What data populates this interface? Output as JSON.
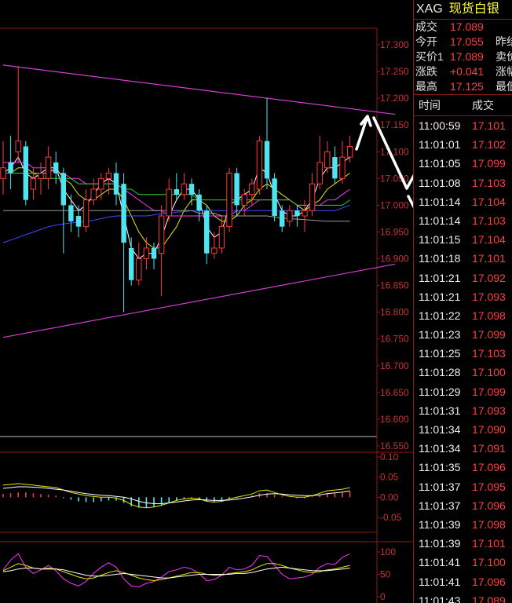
{
  "quote_panel": {
    "symbol": "XAG",
    "name": "现货白银",
    "rows": [
      {
        "label": "成交",
        "value": "17.089",
        "label2": ""
      },
      {
        "label": "今开",
        "value": "17.055",
        "label2": "昨结"
      },
      {
        "label": "买价1",
        "value": "17.089",
        "label2": "卖价"
      },
      {
        "label": "涨跌",
        "value": "+0.041",
        "label2": "涨幅"
      },
      {
        "label": "最高",
        "value": "17.125",
        "label2": "最低"
      }
    ]
  },
  "trades": {
    "col_time": "时间",
    "col_price": "成交",
    "rows": [
      {
        "time": "11:00:59",
        "price": "17.101"
      },
      {
        "time": "11:01:01",
        "price": "17.102"
      },
      {
        "time": "11:01:05",
        "price": "17.099"
      },
      {
        "time": "11:01:08",
        "price": "17.103"
      },
      {
        "time": "11:01:14",
        "price": "17.104"
      },
      {
        "time": "11:01:14",
        "price": "17.103"
      },
      {
        "time": "11:01:15",
        "price": "17.104"
      },
      {
        "time": "11:01:18",
        "price": "17.101"
      },
      {
        "time": "11:01:21",
        "price": "17.092"
      },
      {
        "time": "11:01:21",
        "price": "17.093"
      },
      {
        "time": "11:01:22",
        "price": "17.098"
      },
      {
        "time": "11:01:23",
        "price": "17.099"
      },
      {
        "time": "11:01:25",
        "price": "17.103"
      },
      {
        "time": "11:01:28",
        "price": "17.100"
      },
      {
        "time": "11:01:29",
        "price": "17.099"
      },
      {
        "time": "11:01:31",
        "price": "17.093"
      },
      {
        "time": "11:01:34",
        "price": "17.090"
      },
      {
        "time": "11:01:34",
        "price": "17.091"
      },
      {
        "time": "11:01:35",
        "price": "17.096"
      },
      {
        "time": "11:01:37",
        "price": "17.095"
      },
      {
        "time": "11:01:37",
        "price": "17.096"
      },
      {
        "time": "11:01:39",
        "price": "17.098"
      },
      {
        "time": "11:01:39",
        "price": "17.101"
      },
      {
        "time": "11:01:41",
        "price": "17.100"
      },
      {
        "time": "11:01:41",
        "price": "17.096"
      },
      {
        "time": "11:01:43",
        "price": "17.089"
      }
    ]
  },
  "chart_data": [
    {
      "type": "candlestick",
      "panel": "price",
      "ylim": [
        16.52,
        17.33
      ],
      "y_ticks": [
        "17.300",
        "17.250",
        "17.200",
        "17.150",
        "17.100",
        "17.050",
        "17.000",
        "16.950",
        "16.900",
        "16.850",
        "16.800",
        "16.750",
        "16.700",
        "16.650",
        "16.600",
        "16.550"
      ],
      "candles": [
        {
          "o": 17.05,
          "c": 17.07,
          "h": 17.12,
          "l": 17.02
        },
        {
          "o": 17.08,
          "c": 17.06,
          "h": 17.13,
          "l": 17.03
        },
        {
          "o": 17.1,
          "c": 17.12,
          "h": 17.26,
          "l": 17.08
        },
        {
          "o": 17.11,
          "c": 17.01,
          "h": 17.12,
          "l": 17.0
        },
        {
          "o": 17.03,
          "c": 17.05,
          "h": 17.07,
          "l": 17.01
        },
        {
          "o": 17.05,
          "c": 17.06,
          "h": 17.08,
          "l": 17.02
        },
        {
          "o": 17.05,
          "c": 17.09,
          "h": 17.11,
          "l": 17.03
        },
        {
          "o": 17.08,
          "c": 17.06,
          "h": 17.1,
          "l": 17.04
        },
        {
          "o": 17.06,
          "c": 17.0,
          "h": 17.07,
          "l": 16.91
        },
        {
          "o": 17.0,
          "c": 16.97,
          "h": 17.02,
          "l": 16.95
        },
        {
          "o": 16.98,
          "c": 16.96,
          "h": 17.0,
          "l": 16.94
        },
        {
          "o": 16.96,
          "c": 17.01,
          "h": 17.03,
          "l": 16.95
        },
        {
          "o": 17.01,
          "c": 17.03,
          "h": 17.05,
          "l": 17.0
        },
        {
          "o": 17.03,
          "c": 17.05,
          "h": 17.06,
          "l": 17.01
        },
        {
          "o": 17.05,
          "c": 17.06,
          "h": 17.07,
          "l": 17.02
        },
        {
          "o": 17.06,
          "c": 17.02,
          "h": 17.08,
          "l": 17.0
        },
        {
          "o": 17.04,
          "c": 16.93,
          "h": 17.06,
          "l": 16.8
        },
        {
          "o": 16.92,
          "c": 16.86,
          "h": 16.94,
          "l": 16.85
        },
        {
          "o": 16.86,
          "c": 16.9,
          "h": 16.93,
          "l": 16.85
        },
        {
          "o": 16.9,
          "c": 16.92,
          "h": 16.94,
          "l": 16.88
        },
        {
          "o": 16.92,
          "c": 16.9,
          "h": 16.93,
          "l": 16.88
        },
        {
          "o": 16.91,
          "c": 16.98,
          "h": 17.0,
          "l": 16.83
        },
        {
          "o": 16.98,
          "c": 17.03,
          "h": 17.05,
          "l": 16.97
        },
        {
          "o": 17.03,
          "c": 17.02,
          "h": 17.06,
          "l": 17.01
        },
        {
          "o": 17.02,
          "c": 17.04,
          "h": 17.06,
          "l": 17.01
        },
        {
          "o": 17.04,
          "c": 17.02,
          "h": 17.05,
          "l": 17.0
        },
        {
          "o": 17.02,
          "c": 16.99,
          "h": 17.03,
          "l": 16.97
        },
        {
          "o": 16.99,
          "c": 16.91,
          "h": 17.0,
          "l": 16.89
        },
        {
          "o": 16.91,
          "c": 16.92,
          "h": 16.95,
          "l": 16.9
        },
        {
          "o": 16.92,
          "c": 16.96,
          "h": 16.98,
          "l": 16.91
        },
        {
          "o": 16.96,
          "c": 17.06,
          "h": 17.07,
          "l": 16.95
        },
        {
          "o": 17.06,
          "c": 17.0,
          "h": 17.07,
          "l": 16.98
        },
        {
          "o": 17.0,
          "c": 17.02,
          "h": 17.03,
          "l": 16.98
        },
        {
          "o": 17.02,
          "c": 17.04,
          "h": 17.05,
          "l": 17.0
        },
        {
          "o": 17.03,
          "c": 17.12,
          "h": 17.13,
          "l": 17.02
        },
        {
          "o": 17.12,
          "c": 17.05,
          "h": 17.2,
          "l": 17.03
        },
        {
          "o": 17.05,
          "c": 16.98,
          "h": 17.06,
          "l": 16.97
        },
        {
          "o": 16.99,
          "c": 16.96,
          "h": 17.0,
          "l": 16.95
        },
        {
          "o": 16.97,
          "c": 16.99,
          "h": 17.0,
          "l": 16.96
        },
        {
          "o": 16.99,
          "c": 16.98,
          "h": 17.0,
          "l": 16.96
        },
        {
          "o": 16.98,
          "c": 16.99,
          "h": 17.01,
          "l": 16.95
        },
        {
          "o": 16.99,
          "c": 17.04,
          "h": 17.06,
          "l": 16.98
        },
        {
          "o": 17.04,
          "c": 17.08,
          "h": 17.13,
          "l": 17.03
        },
        {
          "o": 17.07,
          "c": 17.1,
          "h": 17.12,
          "l": 17.06
        },
        {
          "o": 17.09,
          "c": 17.05,
          "h": 17.11,
          "l": 17.04
        },
        {
          "o": 17.05,
          "c": 17.09,
          "h": 17.12,
          "l": 17.04
        },
        {
          "o": 17.09,
          "c": 17.11,
          "h": 17.13,
          "l": 17.08
        }
      ],
      "trend_lines": [
        {
          "from": [
            0,
            17.262
          ],
          "to": [
            52,
            17.17
          ]
        },
        {
          "from": [
            0,
            16.753
          ],
          "to": [
            52,
            16.89
          ]
        }
      ],
      "moving_averages": [
        {
          "color": "#ffffff",
          "values": [
            17.06,
            17.07,
            17.09,
            17.06,
            17.05,
            17.06,
            17.07,
            17.07,
            17.03,
            17.01,
            16.99,
            17.0,
            17.02,
            17.04,
            17.05,
            17.04,
            16.98,
            16.92,
            16.9,
            16.91,
            16.91,
            16.94,
            16.98,
            17.01,
            17.03,
            17.03,
            17.01,
            16.96,
            16.94,
            16.95,
            17.0,
            17.01,
            17.02,
            17.03,
            17.07,
            17.06,
            17.02,
            16.99,
            16.98,
            16.98,
            16.99,
            17.01,
            17.05,
            17.07,
            17.07,
            17.08,
            17.09
          ]
        },
        {
          "color": "#e6e600",
          "values": [
            17.06,
            17.06,
            17.07,
            17.07,
            17.06,
            17.06,
            17.06,
            17.07,
            17.05,
            17.04,
            17.02,
            17.01,
            17.01,
            17.02,
            17.03,
            17.03,
            17.01,
            16.98,
            16.95,
            16.93,
            16.92,
            16.92,
            16.94,
            16.96,
            16.99,
            17.01,
            17.01,
            17.0,
            16.98,
            16.97,
            16.97,
            16.98,
            17.0,
            17.01,
            17.03,
            17.04,
            17.03,
            17.02,
            17.01,
            17.0,
            16.99,
            17.0,
            17.01,
            17.03,
            17.04,
            17.05,
            17.06
          ]
        },
        {
          "color": "#ff33ff",
          "values": [
            17.08,
            17.08,
            17.08,
            17.08,
            17.07,
            17.07,
            17.07,
            17.06,
            17.06,
            17.05,
            17.05,
            17.04,
            17.04,
            17.04,
            17.04,
            17.04,
            17.03,
            17.02,
            17.01,
            17.0,
            16.99,
            16.99,
            16.98,
            16.98,
            16.98,
            16.98,
            16.98,
            16.98,
            16.98,
            16.98,
            16.98,
            16.99,
            16.99,
            17.0,
            17.01,
            17.01,
            17.01,
            17.01,
            17.01,
            17.0,
            17.0,
            17.0,
            17.0,
            17.01,
            17.01,
            17.02,
            17.03
          ]
        },
        {
          "color": "#33cc33",
          "values": [
            17.06,
            17.06,
            17.06,
            17.06,
            17.06,
            17.05,
            17.05,
            17.05,
            17.05,
            17.05,
            17.04,
            17.04,
            17.04,
            17.04,
            17.04,
            17.04,
            17.03,
            17.03,
            17.02,
            17.02,
            17.02,
            17.02,
            17.02,
            17.02,
            17.02,
            17.02,
            17.01,
            17.01,
            17.01,
            17.01,
            17.01,
            17.01,
            17.01,
            17.01,
            17.01,
            17.01,
            17.01,
            17.01,
            17.01,
            17.0,
            17.0,
            17.0,
            17.0,
            17.0,
            17.0,
            17.0,
            17.01
          ]
        },
        {
          "color": "#3a4cff",
          "values": [
            16.93,
            16.935,
            16.94,
            16.945,
            16.95,
            16.955,
            16.96,
            16.963,
            16.965,
            16.967,
            16.968,
            16.97,
            16.972,
            16.975,
            16.978,
            16.98,
            16.98,
            16.98,
            16.98,
            16.98,
            16.982,
            16.984,
            16.985,
            16.987,
            16.988,
            16.99,
            16.99,
            16.99,
            16.99,
            16.99,
            16.99,
            16.99,
            16.99,
            16.99,
            16.99,
            16.99,
            16.99,
            16.99,
            16.99,
            16.99,
            16.99,
            16.99,
            16.99,
            16.99,
            16.99,
            16.995,
            17.0
          ]
        },
        {
          "color": "#9a9a9a",
          "values": [
            16.99,
            16.99,
            16.99,
            16.99,
            16.99,
            16.99,
            16.99,
            16.99,
            16.99,
            16.99,
            16.99,
            16.99,
            16.99,
            16.99,
            16.99,
            16.99,
            16.99,
            16.99,
            16.99,
            16.99,
            16.99,
            16.99,
            16.99,
            16.99,
            16.99,
            16.99,
            16.985,
            16.985,
            16.985,
            16.98,
            16.98,
            16.98,
            16.98,
            16.98,
            16.98,
            16.98,
            16.978,
            16.976,
            16.975,
            16.974,
            16.973,
            16.972,
            16.971,
            16.97,
            16.97,
            16.97,
            16.97
          ]
        }
      ]
    },
    {
      "type": "bar",
      "panel": "macd",
      "ylim": [
        -0.075,
        0.12
      ],
      "y_ticks": [
        "0.10",
        "0.05",
        "0.00",
        "-0.05"
      ],
      "values": [
        0.008,
        0.01,
        0.012,
        0.012,
        0.01,
        0.008,
        0.006,
        0.004,
        -0.002,
        -0.006,
        -0.01,
        -0.012,
        -0.012,
        -0.01,
        -0.008,
        -0.008,
        -0.014,
        -0.022,
        -0.026,
        -0.026,
        -0.024,
        -0.02,
        -0.014,
        -0.008,
        -0.004,
        -0.002,
        -0.004,
        -0.01,
        -0.012,
        -0.01,
        -0.004,
        -0.002,
        0.0,
        0.004,
        0.01,
        0.01,
        0.006,
        0.002,
        0.0,
        -0.002,
        -0.002,
        0.002,
        0.006,
        0.01,
        0.01,
        0.012,
        0.014
      ],
      "lines": [
        {
          "color": "#e6e600",
          "values": [
            0.03,
            0.032,
            0.034,
            0.032,
            0.03,
            0.028,
            0.026,
            0.024,
            0.018,
            0.012,
            0.008,
            0.004,
            0.002,
            0.0,
            0.0,
            -0.002,
            -0.008,
            -0.018,
            -0.024,
            -0.026,
            -0.024,
            -0.02,
            -0.014,
            -0.008,
            -0.004,
            -0.002,
            -0.004,
            -0.01,
            -0.012,
            -0.01,
            -0.004,
            0.0,
            0.004,
            0.008,
            0.016,
            0.018,
            0.012,
            0.006,
            0.002,
            0.0,
            0.0,
            0.004,
            0.01,
            0.016,
            0.018,
            0.02,
            0.024
          ]
        },
        {
          "color": "#ffffff",
          "values": [
            0.022,
            0.024,
            0.026,
            0.026,
            0.025,
            0.024,
            0.022,
            0.02,
            0.018,
            0.015,
            0.012,
            0.009,
            0.007,
            0.005,
            0.004,
            0.002,
            0.0,
            -0.004,
            -0.01,
            -0.014,
            -0.016,
            -0.016,
            -0.014,
            -0.012,
            -0.009,
            -0.007,
            -0.006,
            -0.007,
            -0.008,
            -0.008,
            -0.007,
            -0.005,
            -0.002,
            0.001,
            0.005,
            0.008,
            0.009,
            0.008,
            0.006,
            0.005,
            0.004,
            0.004,
            0.006,
            0.009,
            0.011,
            0.013,
            0.016
          ]
        }
      ]
    },
    {
      "type": "line",
      "panel": "kdj",
      "ylim": [
        0,
        128
      ],
      "y_ticks": [
        "100",
        "50",
        "0"
      ],
      "lines": [
        {
          "color": "#ff33ff",
          "values": [
            60,
            82,
            96,
            66,
            52,
            60,
            70,
            58,
            40,
            30,
            24,
            34,
            52,
            66,
            76,
            66,
            40,
            24,
            22,
            30,
            34,
            44,
            56,
            60,
            66,
            62,
            52,
            36,
            38,
            48,
            66,
            60,
            62,
            70,
            92,
            90,
            70,
            50,
            40,
            42,
            44,
            50,
            66,
            74,
            72,
            88,
            96
          ]
        },
        {
          "color": "#e6e600",
          "values": [
            58,
            66,
            74,
            70,
            64,
            62,
            64,
            62,
            56,
            50,
            44,
            40,
            42,
            48,
            54,
            58,
            54,
            48,
            42,
            38,
            36,
            38,
            42,
            46,
            50,
            54,
            54,
            50,
            48,
            48,
            52,
            54,
            56,
            60,
            68,
            74,
            74,
            70,
            64,
            60,
            56,
            54,
            56,
            60,
            62,
            66,
            70
          ]
        },
        {
          "color": "#ffffff",
          "values": [
            56,
            58,
            62,
            64,
            64,
            62,
            62,
            62,
            60,
            56,
            52,
            48,
            46,
            46,
            48,
            50,
            52,
            50,
            48,
            46,
            44,
            42,
            42,
            44,
            46,
            48,
            50,
            50,
            50,
            50,
            50,
            52,
            52,
            54,
            58,
            62,
            64,
            66,
            64,
            62,
            60,
            58,
            58,
            58,
            60,
            62,
            64
          ]
        }
      ]
    }
  ]
}
